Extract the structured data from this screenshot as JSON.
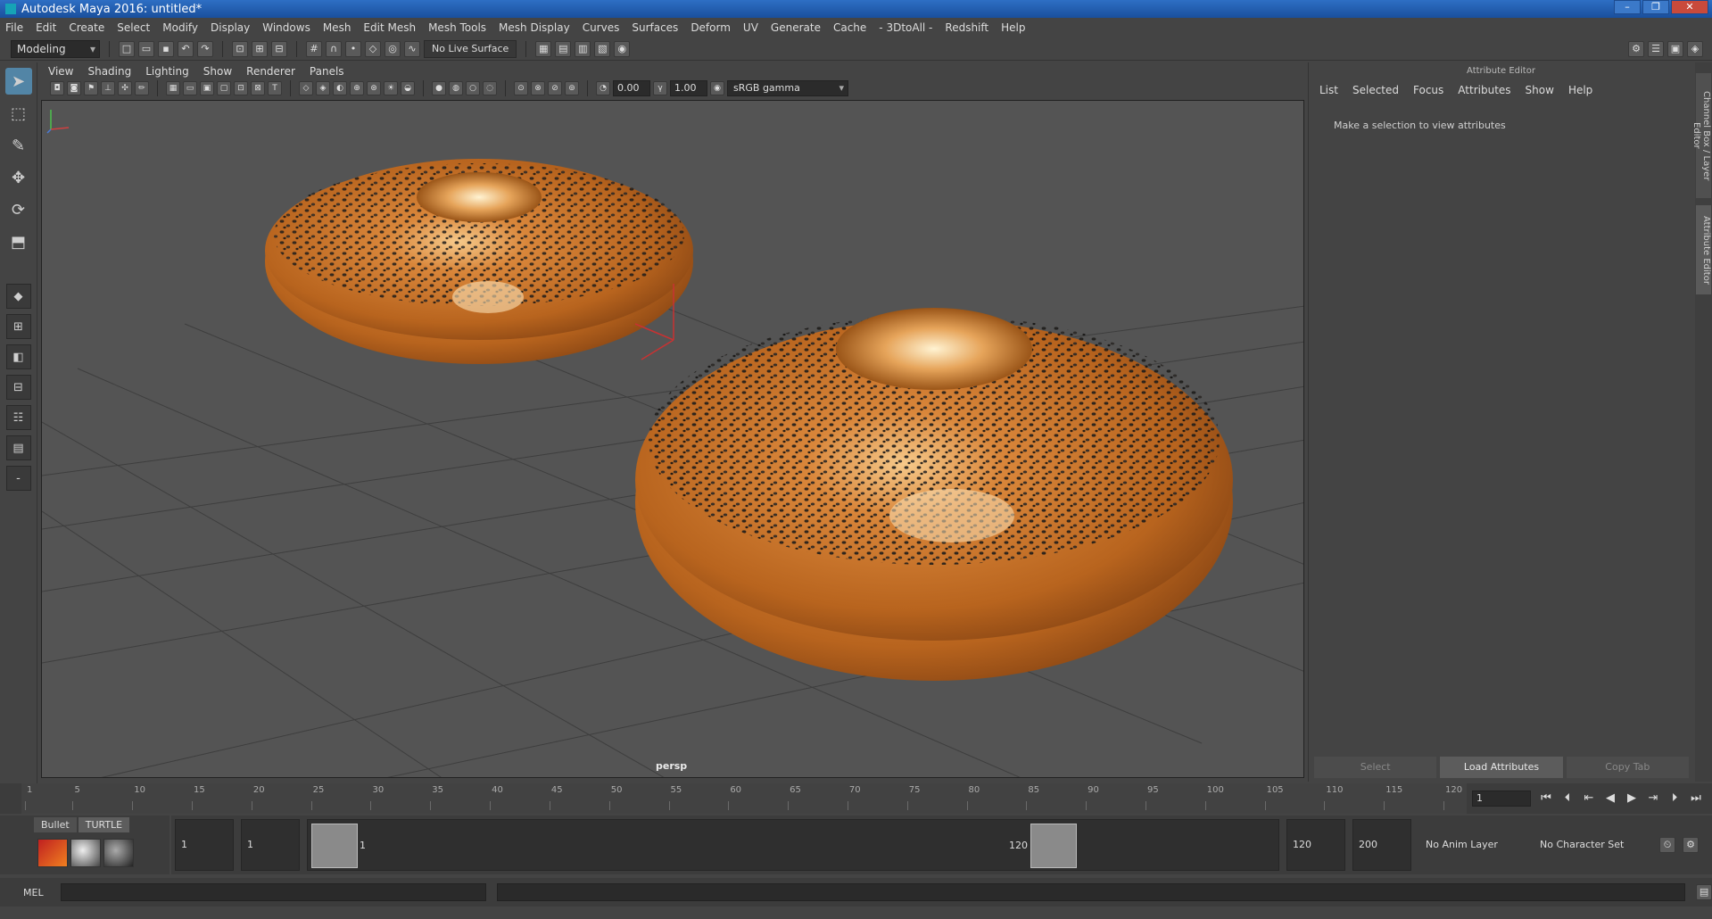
{
  "window": {
    "title": "Autodesk Maya 2016: untitled*"
  },
  "menubar": [
    "File",
    "Edit",
    "Create",
    "Select",
    "Modify",
    "Display",
    "Windows",
    "Mesh",
    "Edit Mesh",
    "Mesh Tools",
    "Mesh Display",
    "Curves",
    "Surfaces",
    "Deform",
    "UV",
    "Generate",
    "Cache",
    "- 3DtoAll -",
    "Redshift",
    "Help"
  ],
  "statusline": {
    "mode": "Modeling",
    "live_surface": "No Live Surface"
  },
  "viewport": {
    "menus": [
      "View",
      "Shading",
      "Lighting",
      "Show",
      "Renderer",
      "Panels"
    ],
    "exposure": "0.00",
    "gamma": "1.00",
    "color_space": "sRGB gamma",
    "camera": "persp"
  },
  "attribute_editor": {
    "title": "Attribute Editor",
    "menus": [
      "List",
      "Selected",
      "Focus",
      "Attributes",
      "Show",
      "Help"
    ],
    "message": "Make a selection to view attributes",
    "buttons": [
      "Select",
      "Load Attributes",
      "Copy Tab"
    ]
  },
  "side_tabs": [
    "Channel Box / Layer Editor",
    "Attribute Editor"
  ],
  "timeline": {
    "ticks": [
      "1",
      "5",
      "10",
      "15",
      "20",
      "25",
      "30",
      "35",
      "40",
      "45",
      "50",
      "55",
      "60",
      "65",
      "70",
      "75",
      "80",
      "85",
      "90",
      "95",
      "100",
      "105",
      "110",
      "115",
      "120"
    ],
    "current_frame": "1"
  },
  "shelf": {
    "tabs": [
      "Bullet",
      "TURTLE"
    ]
  },
  "range": {
    "start": "1",
    "playback_start": "1",
    "inner_start": "1",
    "inner_end": "120",
    "playback_end": "120",
    "end": "200",
    "anim_layer": "No Anim Layer",
    "character_set": "No Character Set"
  },
  "cmdline": {
    "label": "MEL"
  }
}
